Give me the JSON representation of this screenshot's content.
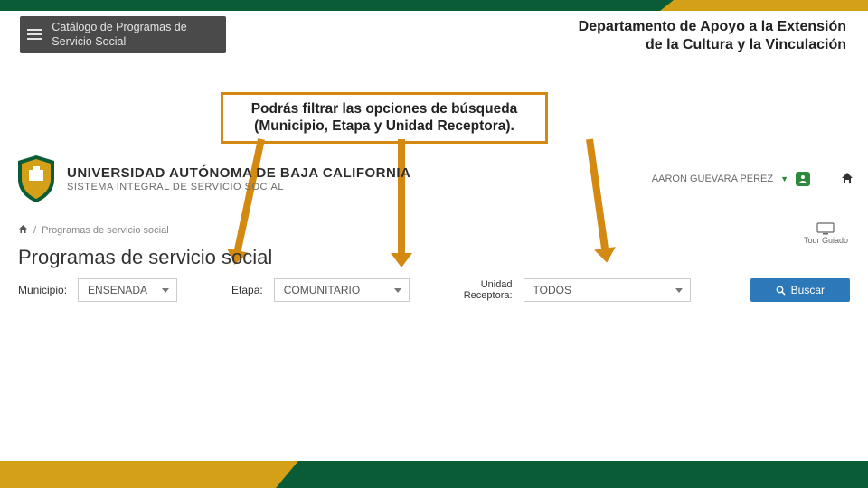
{
  "header_top": {
    "menu_label": "Catálogo de Programas de Servicio Social",
    "dept_line1": "Departamento de Apoyo a la Extensión",
    "dept_line2": "de la Cultura y la Vinculación"
  },
  "callout": {
    "line1": "Podrás filtrar las opciones de búsqueda",
    "line2": "(Municipio, Etapa y Unidad Receptora)."
  },
  "university": {
    "name": "UNIVERSIDAD AUTÓNOMA DE BAJA CALIFORNIA",
    "system": "SISTEMA INTEGRAL DE SERVICIO SOCIAL"
  },
  "user": {
    "name": "AARON GUEVARA PEREZ"
  },
  "breadcrumb": {
    "sep": "/",
    "current": "Programas de servicio social"
  },
  "tour": {
    "label": "Tour Guiado"
  },
  "page": {
    "title": "Programas de servicio social"
  },
  "filters": {
    "municipio_label": "Municipio:",
    "municipio_value": "ENSENADA",
    "etapa_label": "Etapa:",
    "etapa_value": "COMUNITARIO",
    "unidad_label_l1": "Unidad",
    "unidad_label_l2": "Receptora:",
    "unidad_value": "TODOS",
    "search_label": "Buscar"
  },
  "colors": {
    "green": "#0a5c36",
    "gold": "#d4a017",
    "orange": "#d48a12",
    "blue": "#2d78b8"
  }
}
